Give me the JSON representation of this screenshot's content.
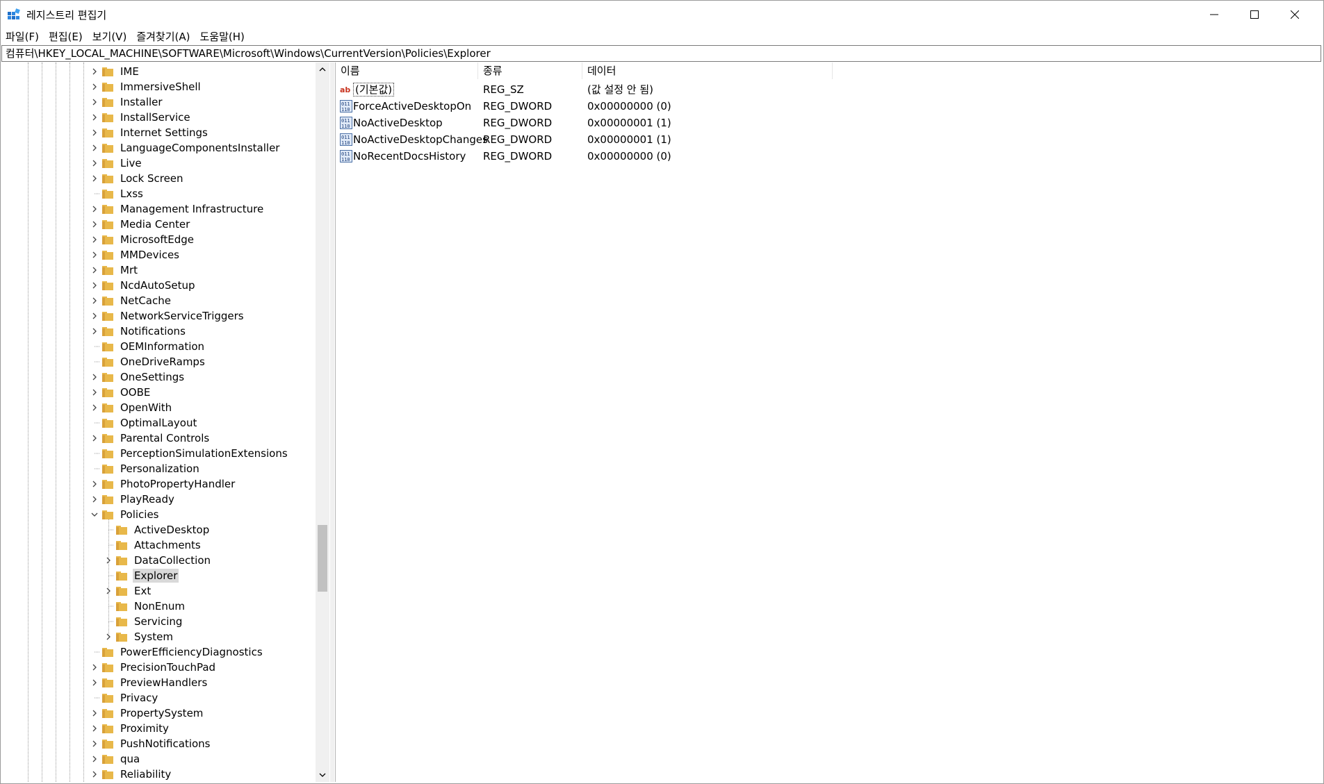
{
  "window": {
    "title": "레지스트리 편집기",
    "controls": [
      "minimize",
      "maximize",
      "close"
    ]
  },
  "menu": [
    "파일(F)",
    "편집(E)",
    "보기(V)",
    "즐겨찾기(A)",
    "도움말(H)"
  ],
  "address": "컴퓨터\\HKEY_LOCAL_MACHINE\\SOFTWARE\\Microsoft\\Windows\\CurrentVersion\\Policies\\Explorer",
  "tree": {
    "items": [
      {
        "label": "IME",
        "expandable": true
      },
      {
        "label": "ImmersiveShell",
        "expandable": true
      },
      {
        "label": "Installer",
        "expandable": true
      },
      {
        "label": "InstallService",
        "expandable": true
      },
      {
        "label": "Internet Settings",
        "expandable": true
      },
      {
        "label": "LanguageComponentsInstaller",
        "expandable": true
      },
      {
        "label": "Live",
        "expandable": true
      },
      {
        "label": "Lock Screen",
        "expandable": true
      },
      {
        "label": "Lxss",
        "expandable": false
      },
      {
        "label": "Management Infrastructure",
        "expandable": true
      },
      {
        "label": "Media Center",
        "expandable": true
      },
      {
        "label": "MicrosoftEdge",
        "expandable": true
      },
      {
        "label": "MMDevices",
        "expandable": true
      },
      {
        "label": "Mrt",
        "expandable": true
      },
      {
        "label": "NcdAutoSetup",
        "expandable": true
      },
      {
        "label": "NetCache",
        "expandable": true
      },
      {
        "label": "NetworkServiceTriggers",
        "expandable": true
      },
      {
        "label": "Notifications",
        "expandable": true
      },
      {
        "label": "OEMInformation",
        "expandable": false
      },
      {
        "label": "OneDriveRamps",
        "expandable": false
      },
      {
        "label": "OneSettings",
        "expandable": true
      },
      {
        "label": "OOBE",
        "expandable": true
      },
      {
        "label": "OpenWith",
        "expandable": true
      },
      {
        "label": "OptimalLayout",
        "expandable": false
      },
      {
        "label": "Parental Controls",
        "expandable": true
      },
      {
        "label": "PerceptionSimulationExtensions",
        "expandable": false
      },
      {
        "label": "Personalization",
        "expandable": false
      },
      {
        "label": "PhotoPropertyHandler",
        "expandable": true
      },
      {
        "label": "PlayReady",
        "expandable": true
      },
      {
        "label": "Policies",
        "expandable": true,
        "expanded": true
      },
      {
        "label": "ActiveDesktop",
        "expandable": false,
        "child": true
      },
      {
        "label": "Attachments",
        "expandable": false,
        "child": true
      },
      {
        "label": "DataCollection",
        "expandable": true,
        "child": true
      },
      {
        "label": "Explorer",
        "expandable": false,
        "child": true,
        "selected": true
      },
      {
        "label": "Ext",
        "expandable": true,
        "child": true
      },
      {
        "label": "NonEnum",
        "expandable": false,
        "child": true
      },
      {
        "label": "Servicing",
        "expandable": false,
        "child": true
      },
      {
        "label": "System",
        "expandable": true,
        "child": true
      },
      {
        "label": "PowerEfficiencyDiagnostics",
        "expandable": false
      },
      {
        "label": "PrecisionTouchPad",
        "expandable": true
      },
      {
        "label": "PreviewHandlers",
        "expandable": true
      },
      {
        "label": "Privacy",
        "expandable": false
      },
      {
        "label": "PropertySystem",
        "expandable": true
      },
      {
        "label": "Proximity",
        "expandable": true
      },
      {
        "label": "PushNotifications",
        "expandable": true
      },
      {
        "label": "qua",
        "expandable": true
      },
      {
        "label": "Reliability",
        "expandable": true
      }
    ]
  },
  "list": {
    "columns": [
      "이름",
      "종류",
      "데이터"
    ],
    "rows": [
      {
        "name": "(기본값)",
        "type": "REG_SZ",
        "data": "(값 설정 안 됨)",
        "icon": "string-value-icon",
        "default": true
      },
      {
        "name": "ForceActiveDesktopOn",
        "type": "REG_DWORD",
        "data": "0x00000000 (0)",
        "icon": "dword-value-icon"
      },
      {
        "name": "NoActiveDesktop",
        "type": "REG_DWORD",
        "data": "0x00000001 (1)",
        "icon": "dword-value-icon"
      },
      {
        "name": "NoActiveDesktopChanges",
        "type": "REG_DWORD",
        "data": "0x00000001 (1)",
        "icon": "dword-value-icon"
      },
      {
        "name": "NoRecentDocsHistory",
        "type": "REG_DWORD",
        "data": "0x00000000 (0)",
        "icon": "dword-value-icon"
      }
    ]
  },
  "colors": {
    "folder": "#e8b84a",
    "selection": "#d9d9d9",
    "scroll_thumb": "#c1c1c1"
  }
}
